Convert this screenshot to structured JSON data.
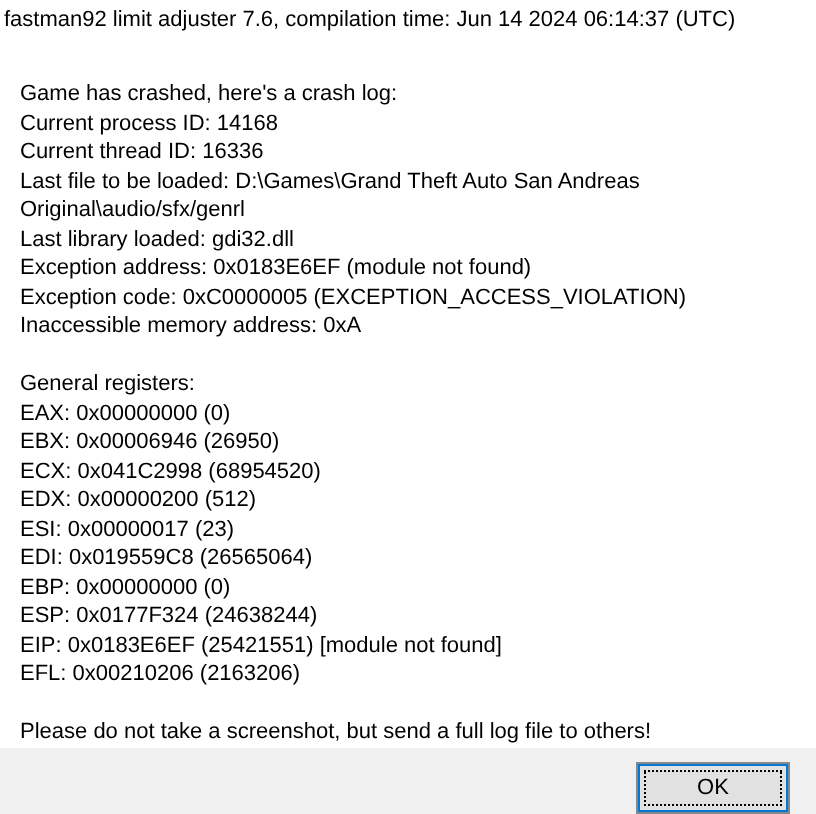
{
  "title": "fastman92 limit adjuster 7.6, compilation time: Jun 14 2024 06:14:37 (UTC)",
  "crash_log": [
    "Game has crashed, here's a crash log:",
    "Current process ID: 14168",
    "Current thread ID: 16336",
    "Last file to be loaded: D:\\Games\\Grand Theft Auto San Andreas Original\\audio/sfx/genrl",
    "Last library loaded: gdi32.dll",
    "Exception address: 0x0183E6EF (module not found)",
    "Exception code: 0xC0000005 (EXCEPTION_ACCESS_VIOLATION)",
    "Inaccessible memory address: 0xA"
  ],
  "registers": {
    "heading": "General registers:",
    "lines": [
      "EAX: 0x00000000 (0)",
      "EBX: 0x00006946 (26950)",
      "ECX: 0x041C2998 (68954520)",
      "EDX: 0x00000200 (512)",
      "ESI: 0x00000017 (23)",
      "EDI: 0x019559C8 (26565064)",
      "EBP: 0x00000000 (0)",
      "ESP: 0x0177F324 (24638244)",
      "EIP: 0x0183E6EF (25421551) [module not found]",
      "EFL: 0x00210206 (2163206)"
    ]
  },
  "notice": "Please do not take a screenshot, but send a full log file to others!",
  "buttons": [
    "OK"
  ]
}
